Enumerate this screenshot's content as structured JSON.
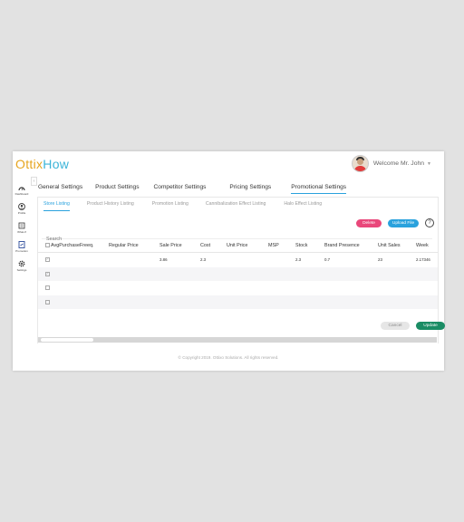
{
  "brand": {
    "logo_part1": "Ottix",
    "logo_part2": "How"
  },
  "user": {
    "welcome": "Welcome Mr. John"
  },
  "sidebar": {
    "items": [
      {
        "label": "Dashboard",
        "icon": "dashboard-icon"
      },
      {
        "label": "Profile",
        "icon": "profile-icon"
      },
      {
        "label": "What-If",
        "icon": "whatif-icon"
      },
      {
        "label": "Promotion",
        "icon": "promotion-icon"
      },
      {
        "label": "Settings",
        "icon": "settings-icon"
      }
    ]
  },
  "tabs": [
    {
      "label": "General Settings"
    },
    {
      "label": "Product Settings"
    },
    {
      "label": "Competitor Settings"
    },
    {
      "label": "Pricing Settings"
    },
    {
      "label": "Promotional Settings"
    }
  ],
  "subtabs": [
    {
      "label": "Store Listing"
    },
    {
      "label": "Product History Listing"
    },
    {
      "label": "Promotion Listing"
    },
    {
      "label": "Cannibalization Effect Listing"
    },
    {
      "label": "Halo Effect Listing"
    }
  ],
  "actions": {
    "delete": "Delete",
    "upload": "Upload File",
    "help": "?"
  },
  "search": {
    "placeholder": "Search"
  },
  "table": {
    "columns": [
      "AvgPurchaseFreeq.",
      "Regular Price",
      "Sale Price",
      "Cost",
      "Unit Price",
      "MSP",
      "Stock",
      "Brand Presence",
      "Unit Sales",
      "Week"
    ],
    "rows": [
      [
        "",
        "",
        "3.86",
        "2.3",
        "",
        "",
        "2.3",
        "0.7",
        "23",
        "2.17346"
      ],
      [
        "",
        "",
        "",
        "",
        "",
        "",
        "",
        "",
        "",
        ""
      ],
      [
        "",
        "",
        "",
        "",
        "",
        "",
        "",
        "",
        "",
        ""
      ],
      [
        "",
        "",
        "",
        "",
        "",
        "",
        "",
        "",
        "",
        ""
      ]
    ]
  },
  "form": {
    "cancel": "Cancel",
    "update": "Update"
  },
  "footer": {
    "copyright": "© Copyright 2019. Ottixo Solutions. All rights reserved."
  },
  "colors": {
    "accent": "#2aa2dd",
    "delete": "#e9477a",
    "update": "#1a8c64",
    "logo_orange": "#e6a51f"
  }
}
